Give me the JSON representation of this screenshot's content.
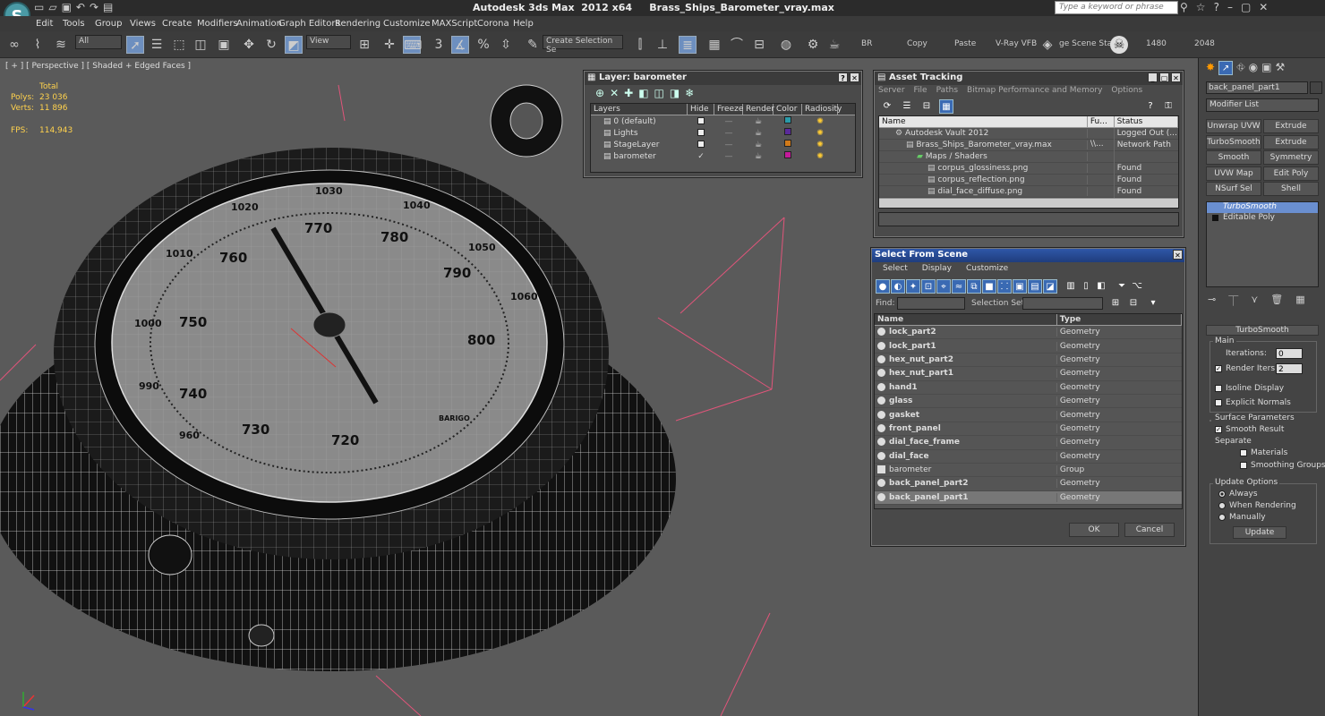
{
  "window": {
    "title": "Autodesk 3ds Max  2012 x64     Brass_Ships_Barometer_vray.max",
    "logo_letter": "S",
    "search_placeholder": "Type a keyword or phrase"
  },
  "menu": [
    "Edit",
    "Tools",
    "Group",
    "Views",
    "Create",
    "Modifiers",
    "Animation",
    "Graph Editors",
    "Rendering",
    "Customize",
    "MAXScript",
    "Corona",
    "Help"
  ],
  "toolbar": {
    "selection_filter": "All",
    "ref_coord": "View",
    "named_selection": "Create Selection Se",
    "snap_label": "3",
    "percent_label": "%",
    "labels": [
      "BR",
      "Copy",
      "Paste",
      "V-Ray VFB",
      "ge Scene Stat",
      "1480",
      "2048"
    ]
  },
  "viewport": {
    "label": "[ + ] [ Perspective ] [ Shaded + Edged Faces ]",
    "stats": {
      "total_label": "Total",
      "polys_label": "Polys:",
      "polys": "23 036",
      "verts_label": "Verts:",
      "verts": "11 896",
      "fps_label": "FPS:",
      "fps": "114,943"
    },
    "dial_numbers": [
      "1030",
      "1040",
      "1020",
      "1010",
      "770",
      "780",
      "760",
      "790",
      "1050",
      "1060",
      "750",
      "1000",
      "800",
      "990",
      "740",
      "730",
      "720",
      "960"
    ],
    "dial_brand": "BARIGO"
  },
  "layer_dialog": {
    "title": "Layer: barometer",
    "columns": [
      "Layers",
      "Hide",
      "Freeze",
      "Render",
      "Color",
      "Radiosity"
    ],
    "rows": [
      {
        "name": "0 (default)",
        "color": "#2a9aa8"
      },
      {
        "name": "Lights",
        "color": "#5a2a9a"
      },
      {
        "name": "StageLayer",
        "color": "#d07a1a"
      },
      {
        "name": "barometer",
        "color": "#c41a9a"
      }
    ]
  },
  "asset_tracking": {
    "title": "Asset Tracking",
    "menu": [
      "Server",
      "File",
      "Paths",
      "Bitmap Performance and Memory",
      "Options"
    ],
    "columns": [
      "Name",
      "Fu...",
      "Status"
    ],
    "rows": [
      {
        "name": "Autodesk Vault 2012",
        "full": "",
        "status": "Logged Out (..."
      },
      {
        "name": "Brass_Ships_Barometer_vray.max",
        "full": "\\\\...",
        "status": "Network Path"
      },
      {
        "name": "Maps / Shaders",
        "full": "",
        "status": ""
      },
      {
        "name": "corpus_glossiness.png",
        "full": "",
        "status": "Found"
      },
      {
        "name": "corpus_reflection.png",
        "full": "",
        "status": "Found"
      },
      {
        "name": "dial_face_diffuse.png",
        "full": "",
        "status": "Found"
      }
    ]
  },
  "select_scene": {
    "title": "Select From Scene",
    "menu": [
      "Select",
      "Display",
      "Customize"
    ],
    "find_label": "Find:",
    "selection_set_label": "Selection Set:",
    "columns": [
      "Name",
      "Type"
    ],
    "rows": [
      {
        "name": "lock_part2",
        "type": "Geometry"
      },
      {
        "name": "lock_part1",
        "type": "Geometry"
      },
      {
        "name": "hex_nut_part2",
        "type": "Geometry"
      },
      {
        "name": "hex_nut_part1",
        "type": "Geometry"
      },
      {
        "name": "hand1",
        "type": "Geometry"
      },
      {
        "name": "glass",
        "type": "Geometry"
      },
      {
        "name": "gasket",
        "type": "Geometry"
      },
      {
        "name": "front_panel",
        "type": "Geometry"
      },
      {
        "name": "dial_face_frame",
        "type": "Geometry"
      },
      {
        "name": "dial_face",
        "type": "Geometry"
      },
      {
        "name": "barometer",
        "type": "Group"
      },
      {
        "name": "back_panel_part2",
        "type": "Geometry"
      },
      {
        "name": "back_panel_part1",
        "type": "Geometry"
      }
    ],
    "ok_label": "OK",
    "cancel_label": "Cancel"
  },
  "command_panel": {
    "object_name": "back_panel_part1",
    "modifier_list": "Modifier List",
    "buttons": [
      "Unwrap UVW",
      "Extrude",
      "TurboSmooth",
      "Extrude",
      "Smooth",
      "Symmetry",
      "UVW Map",
      "Edit Poly",
      "NSurf Sel",
      "Shell"
    ],
    "stack": [
      "TurboSmooth",
      "Editable Poly"
    ],
    "rollout_title": "TurboSmooth",
    "main_label": "Main",
    "iterations_label": "Iterations:",
    "iterations": "0",
    "render_iters_label": "Render Iters:",
    "render_iters": "2",
    "isoline_label": "Isoline Display",
    "explicit_label": "Explicit Normals",
    "surface_label": "Surface Parameters",
    "smooth_result_label": "Smooth Result",
    "separate_label": "Separate",
    "materials_label": "Materials",
    "smoothing_groups_label": "Smoothing Groups",
    "update_options_label": "Update Options",
    "always_label": "Always",
    "when_rendering_label": "When Rendering",
    "manually_label": "Manually",
    "update_label": "Update"
  }
}
